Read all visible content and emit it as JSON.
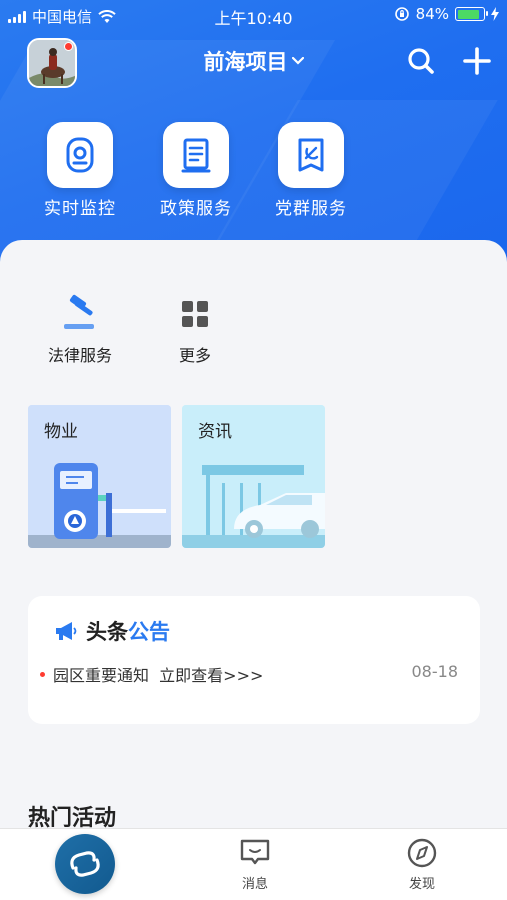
{
  "status_bar": {
    "carrier": "中国电信",
    "time": "上午10:40",
    "battery_percent": "84%"
  },
  "header": {
    "project_title": "前海项目",
    "chevron": "⌄",
    "search_icon": "search-icon",
    "add_icon": "plus-icon"
  },
  "quick_services": [
    {
      "label": "实时监控",
      "icon": "monitor-icon"
    },
    {
      "label": "政策服务",
      "icon": "document-icon"
    },
    {
      "label": "党群服务",
      "icon": "party-badge-icon"
    }
  ],
  "services": [
    {
      "label": "法律服务",
      "icon": "gavel-icon"
    },
    {
      "label": "更多",
      "icon": "grid-icon"
    }
  ],
  "cards": [
    {
      "label": "物业",
      "illustration": "parking-gate-illustration"
    },
    {
      "label": "资讯",
      "illustration": "car-station-illustration"
    }
  ],
  "notice": {
    "title_part1": "头条",
    "title_part2": "公告",
    "item_text": "园区重要通知  立即查看>>>",
    "item_date": "08-18"
  },
  "hot_section_title": "热门活动",
  "tabbar": {
    "home_icon": "link-icon",
    "messages_label": "消息",
    "discover_label": "发现"
  },
  "colors": {
    "primary": "#1f6ef0",
    "accent_blue": "#2a7af0",
    "notice_dot": "#ff3b30",
    "home_button": "#125a8f"
  }
}
